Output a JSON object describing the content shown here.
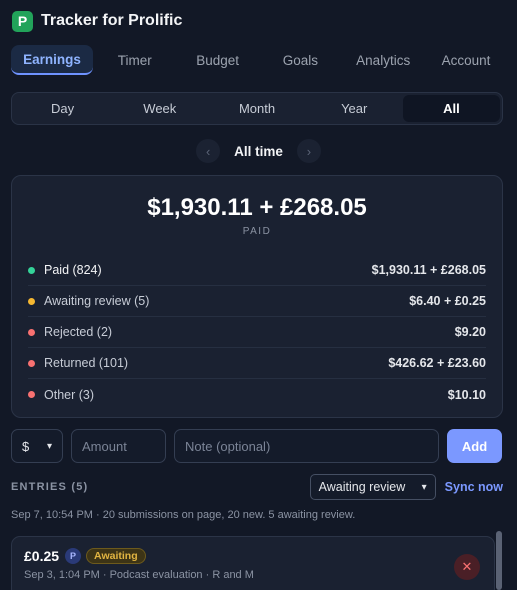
{
  "app": {
    "logo_letter": "P",
    "title": "Tracker for Prolific"
  },
  "tabs": [
    {
      "label": "Earnings",
      "active": true
    },
    {
      "label": "Timer"
    },
    {
      "label": "Budget"
    },
    {
      "label": "Goals"
    },
    {
      "label": "Analytics"
    },
    {
      "label": "Account"
    }
  ],
  "periods": [
    "Day",
    "Week",
    "Month",
    "Year",
    "All"
  ],
  "active_period": "All",
  "period_nav": {
    "label": "All time",
    "prev_icon": "chevron-left-icon",
    "next_icon": "chevron-right-icon"
  },
  "summary": {
    "total": "$1,930.11 + £268.05",
    "caption": "PAID",
    "rows": [
      {
        "label": "Paid (824)",
        "value": "$1,930.11 + £268.05",
        "color": "#34d399"
      },
      {
        "label": "Awaiting review (5)",
        "value": "$6.40 + £0.25",
        "color": "#f5b731"
      },
      {
        "label": "Rejected (2)",
        "value": "$9.20",
        "color": "#f87171"
      },
      {
        "label": "Returned (101)",
        "value": "$426.62 + £23.60",
        "color": "#f87171"
      },
      {
        "label": "Other (3)",
        "value": "$10.10",
        "color": "#f87171"
      }
    ]
  },
  "add_form": {
    "currency": "$",
    "amount_placeholder": "Amount",
    "note_placeholder": "Note (optional)",
    "add_label": "Add"
  },
  "entries": {
    "label": "ENTRIES (5)",
    "filter_value": "Awaiting review",
    "sync_label": "Sync now",
    "status_text": "Sep 7, 10:54 PM · 20 submissions on page, 20 new. 5 awaiting review.",
    "items": [
      {
        "amount": "£0.25",
        "platform": "P",
        "status": "Awaiting",
        "meta": "Sep 3, 1:04 PM · Podcast evaluation · R and M"
      }
    ]
  },
  "colors": {
    "accent": "#7b98ff",
    "background": "#121826",
    "card": "#1a2131"
  }
}
